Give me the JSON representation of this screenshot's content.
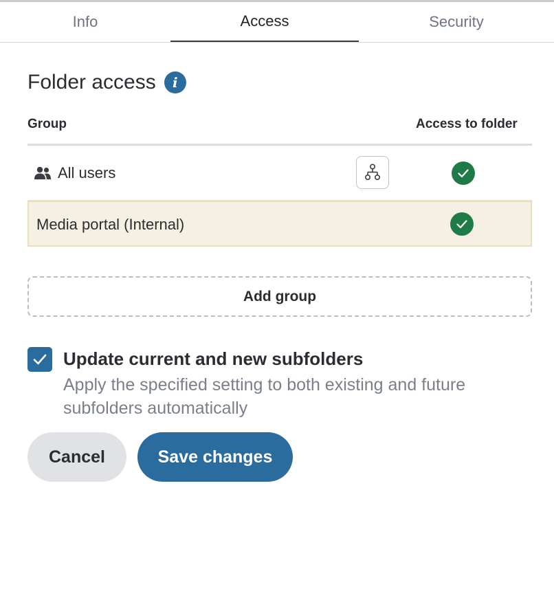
{
  "tabs": [
    {
      "label": "Info",
      "active": false
    },
    {
      "label": "Access",
      "active": true
    },
    {
      "label": "Security",
      "active": false
    }
  ],
  "panel": {
    "title": "Folder access",
    "info_icon": "info-icon"
  },
  "table": {
    "headers": {
      "group": "Group",
      "access": "Access to folder"
    },
    "rows": [
      {
        "label": "All users",
        "icon": "users-icon",
        "has_hierarchy_button": true,
        "access": true
      },
      {
        "label": "Media portal (Internal)",
        "highlighted": true,
        "access": true
      }
    ]
  },
  "add_group_label": "Add group",
  "subfolders": {
    "checked": true,
    "title": "Update current and new subfolders",
    "description": "Apply the specified setting to both existing and future subfolders automatically"
  },
  "actions": {
    "cancel_label": "Cancel",
    "save_label": "Save changes"
  },
  "colors": {
    "primary": "#2b6c9f",
    "success": "#1e7a46",
    "highlight_row": "#f5f0e3",
    "cancel_bg": "#e1e2e5"
  }
}
